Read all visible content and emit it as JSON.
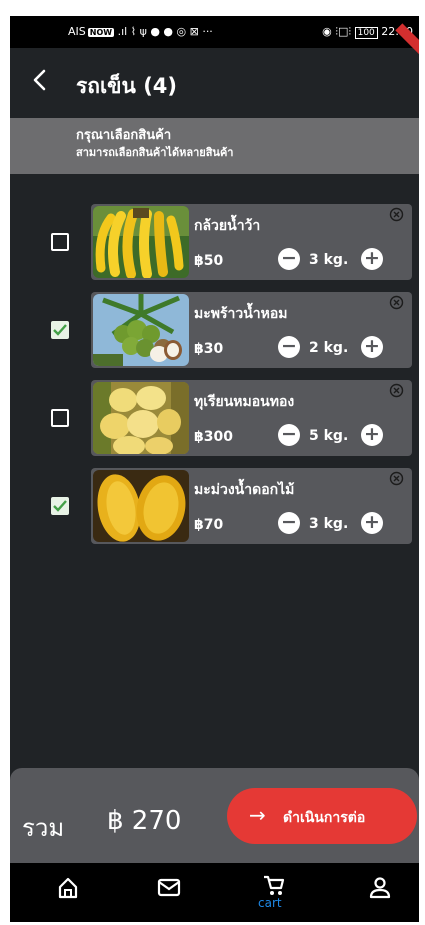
{
  "status_bar": {
    "carrier": "AIS",
    "badge": "NOW",
    "icons_text": ".ıl ⌇ ψ ● ● ◎ ⊠ ···",
    "right_icons_text": "◉ ⫶□⫶",
    "battery": "100",
    "time": "22:50"
  },
  "header": {
    "back_icon": "back-arrow-icon",
    "title": "รถเข็น (4)"
  },
  "notice": {
    "line1": "กรุณาเลือกสินค้า",
    "line2": "สามารถเลือกสินค้าได้หลายสินค้า"
  },
  "cart": {
    "items": [
      {
        "name": "กล้วยน้ำว้า",
        "price": "฿50",
        "qty": "3 kg.",
        "checked": false
      },
      {
        "name": "มะพร้าวน้ำหอม",
        "price": "฿30",
        "qty": "2 kg.",
        "checked": true
      },
      {
        "name": "ทุเรียนหมอนทอง",
        "price": "฿300",
        "qty": "5 kg.",
        "checked": false
      },
      {
        "name": "มะม่วงน้ำดอกไม้",
        "price": "฿70",
        "qty": "3 kg.",
        "checked": true
      }
    ]
  },
  "footer": {
    "total_label": "รวม",
    "total_value": "฿ 270",
    "proceed_label": "ดำเนินการต่อ"
  },
  "bottom_nav": {
    "items": [
      {
        "icon": "home-icon",
        "label": ""
      },
      {
        "icon": "mail-icon",
        "label": ""
      },
      {
        "icon": "cart-icon",
        "label": "cart",
        "active": true
      },
      {
        "icon": "user-icon",
        "label": ""
      }
    ]
  },
  "colors": {
    "background": "#202326",
    "card": "#57585c",
    "notice": "#6d6d6f",
    "accent": "#e53935",
    "check": "#43a047",
    "active_nav": "#1e88e5"
  }
}
